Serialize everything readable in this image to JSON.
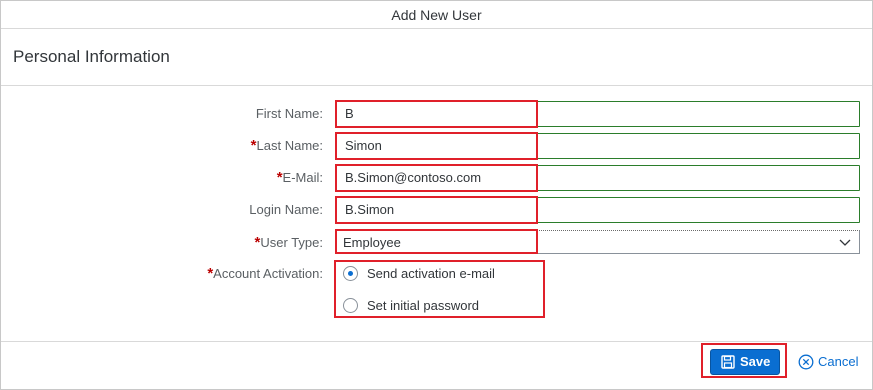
{
  "dialog": {
    "title": "Add New User",
    "section_title": "Personal Information"
  },
  "form": {
    "first_name": {
      "label": "First Name:",
      "required": false,
      "value": "B"
    },
    "last_name": {
      "label": "Last Name:",
      "required": true,
      "required_mark": "*",
      "value": "Simon"
    },
    "email": {
      "label": "E-Mail:",
      "required": true,
      "required_mark": "*",
      "value": "B.Simon@contoso.com"
    },
    "login_name": {
      "label": "Login Name:",
      "required": false,
      "value": "B.Simon"
    },
    "user_type": {
      "label": "User Type:",
      "required": true,
      "required_mark": "*",
      "value": "Employee"
    },
    "account_activation": {
      "label": "Account Activation:",
      "required": true,
      "required_mark": "*",
      "options": [
        {
          "label": "Send activation e-mail",
          "selected": true
        },
        {
          "label": "Set initial password",
          "selected": false
        }
      ]
    }
  },
  "footer": {
    "save_label": "Save",
    "cancel_label": "Cancel"
  },
  "colors": {
    "accent": "#0a6ed1",
    "required": "#bb0000",
    "valid_border": "#2b7d2b",
    "highlight": "#e0202a"
  },
  "icons": {
    "save": "floppy-disk-icon",
    "cancel": "circle-x-icon",
    "dropdown": "chevron-down-icon"
  }
}
